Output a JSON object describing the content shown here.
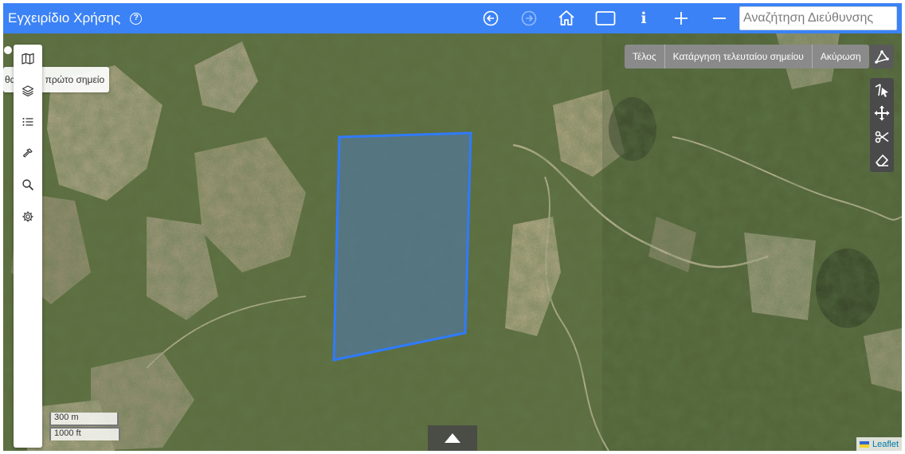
{
  "header": {
    "title": "Εγχειρίδιο Χρήσης",
    "search_placeholder": "Αναζήτηση Διεύθυνσης"
  },
  "tooltip": {
    "left_text": "θα",
    "text": "το πρώτο σημείο"
  },
  "draw_actions": {
    "finish": "Τέλος",
    "delete_last": "Κατάργηση τελευταίου σημείου",
    "cancel": "Ακύρωση"
  },
  "scale": {
    "metric": "300 m",
    "imperial": "1000 ft"
  },
  "attribution": "Leaflet",
  "colors": {
    "header_bg": "#3b82f6",
    "polygon_stroke": "#2f7bff",
    "polygon_fill": "#4a7fd8"
  }
}
